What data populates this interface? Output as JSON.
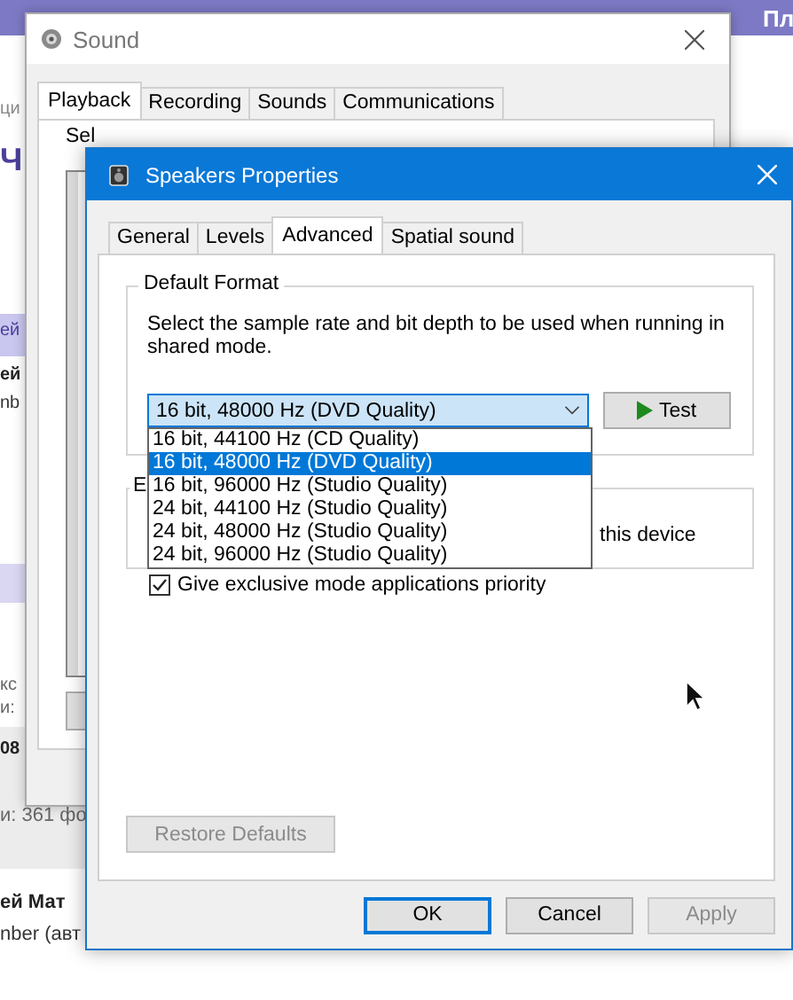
{
  "background_page": {
    "header_text": "Пл",
    "fragments": [
      {
        "text": "ци",
        "kind": "plain"
      },
      {
        "text": "Ч",
        "kind": "big"
      },
      {
        "text": "ей",
        "kind": "band"
      },
      {
        "text": "ей",
        "kind": "bold"
      },
      {
        "text": "nb",
        "kind": "plain"
      },
      {
        "text": "кс",
        "kind": "plain"
      },
      {
        "text": "и:",
        "kind": "plain"
      },
      {
        "text": "08",
        "kind": "bold"
      },
      {
        "text": "и: 361 фо",
        "kind": "plain"
      },
      {
        "text": "ей Мат",
        "kind": "bold"
      },
      {
        "text": "nber (авт",
        "kind": "plain"
      }
    ]
  },
  "sound_window": {
    "title": "Sound",
    "tabs": [
      {
        "label": "Playback",
        "selected": true
      },
      {
        "label": "Recording",
        "selected": false
      },
      {
        "label": "Sounds",
        "selected": false
      },
      {
        "label": "Communications",
        "selected": false
      }
    ],
    "instruction": "Sel"
  },
  "properties_dialog": {
    "title": "Speakers Properties",
    "tabs": [
      {
        "label": "General",
        "selected": false
      },
      {
        "label": "Levels",
        "selected": false
      },
      {
        "label": "Advanced",
        "selected": true
      },
      {
        "label": "Spatial sound",
        "selected": false
      }
    ],
    "default_format": {
      "label": "Default Format",
      "description": "Select the sample rate and bit depth to be used when running in shared mode.",
      "dropdown": {
        "value": "16 bit, 48000 Hz (DVD Quality)",
        "expanded": true,
        "options": [
          {
            "label": "16 bit, 44100 Hz (CD Quality)",
            "selected": false
          },
          {
            "label": "16 bit, 48000 Hz (DVD Quality)",
            "selected": true
          },
          {
            "label": "16 bit, 96000 Hz (Studio Quality)",
            "selected": false
          },
          {
            "label": "24 bit, 44100 Hz (Studio Quality)",
            "selected": false
          },
          {
            "label": "24 bit, 48000 Hz (Studio Quality)",
            "selected": false
          },
          {
            "label": "24 bit, 96000 Hz (Studio Quality)",
            "selected": false
          }
        ]
      },
      "test_button": "Test"
    },
    "exclusive_mode": {
      "label": "E",
      "option_1_tail": "this device",
      "option_2": {
        "label": "Give exclusive mode applications priority",
        "checked": true
      }
    },
    "restore_button": {
      "label": "Restore Defaults",
      "disabled": true
    },
    "buttons": [
      {
        "label": "OK",
        "default": true,
        "disabled": false
      },
      {
        "label": "Cancel",
        "default": false,
        "disabled": false
      },
      {
        "label": "Apply",
        "default": false,
        "disabled": true
      }
    ]
  }
}
